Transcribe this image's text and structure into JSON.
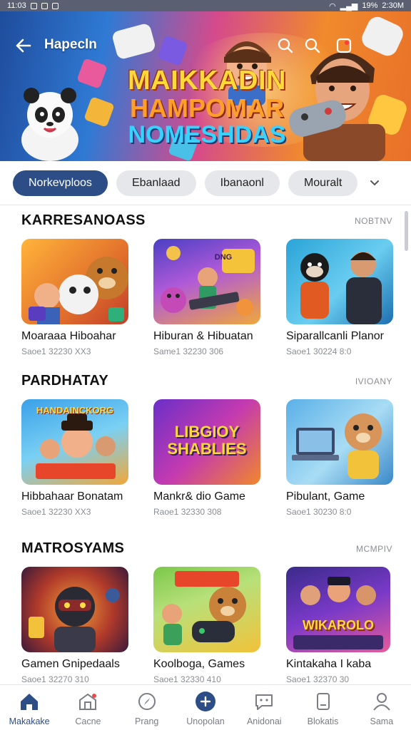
{
  "status_bar": {
    "time": "11:03",
    "battery": "19%",
    "clock_right": "2:30M"
  },
  "header": {
    "title": "Hapecln"
  },
  "hero": {
    "line1": "MAIKKADIN",
    "line2": "HAMPOMAR",
    "line3": "NOMESHDAS"
  },
  "tabs": [
    {
      "label": "Norkevploos",
      "active": true
    },
    {
      "label": "Ebanlaad",
      "active": false
    },
    {
      "label": "Ibanaonl",
      "active": false
    },
    {
      "label": "Mouralt",
      "active": false
    }
  ],
  "sections": [
    {
      "title": "KARRESANOASS",
      "link": "NOBTNV",
      "cards": [
        {
          "title": "Moaraaa Hiboahar",
          "meta": "Saoe1 32230 XX3"
        },
        {
          "title": "Hiburan & Hibuatan",
          "meta": "Same1 32230 306"
        },
        {
          "title": "Siparallcanli Planor",
          "meta": "Saoe1 30224 8:0"
        }
      ]
    },
    {
      "title": "PARDHATAY",
      "link": "IVIOANY",
      "cards": [
        {
          "title": "Hibbahaar Bonatam",
          "meta": "Saoe1 32230 XX3",
          "thumb_text": "HANDAINCKORG"
        },
        {
          "title": "Mankr& dio Game",
          "meta": "Raoe1 32330 308",
          "thumb_text": "LIBGIOY SHABLIES"
        },
        {
          "title": "Pibulant, Game",
          "meta": "Saoe1 30230 8:0"
        }
      ]
    },
    {
      "title": "MATROSYAMS",
      "link": "MCMPIV",
      "cards": [
        {
          "title": "Gamen Gnipedaals",
          "meta": "Saoe1 32270 310"
        },
        {
          "title": "Koolboga, Games",
          "meta": "Saoe1 32330 410"
        },
        {
          "title": "Kintakaha I kaba",
          "meta": "Saoe1 32370 30",
          "thumb_text": "WIKAROLO"
        }
      ]
    }
  ],
  "nav": [
    {
      "label": "Makakake",
      "icon": "home-icon",
      "active": true
    },
    {
      "label": "Cacne",
      "icon": "store-icon",
      "active": false
    },
    {
      "label": "Prang",
      "icon": "compass-icon",
      "active": false
    },
    {
      "label": "Unopolan",
      "icon": "games-icon",
      "active": false
    },
    {
      "label": "Anidonai",
      "icon": "chat-icon",
      "active": false
    },
    {
      "label": "Blokatis",
      "icon": "library-icon",
      "active": false
    },
    {
      "label": "Sama",
      "icon": "profile-icon",
      "active": false
    }
  ],
  "colors": {
    "accent": "#2d4d86",
    "tab_inactive": "#e6e7ea",
    "muted": "#8a8d93"
  }
}
